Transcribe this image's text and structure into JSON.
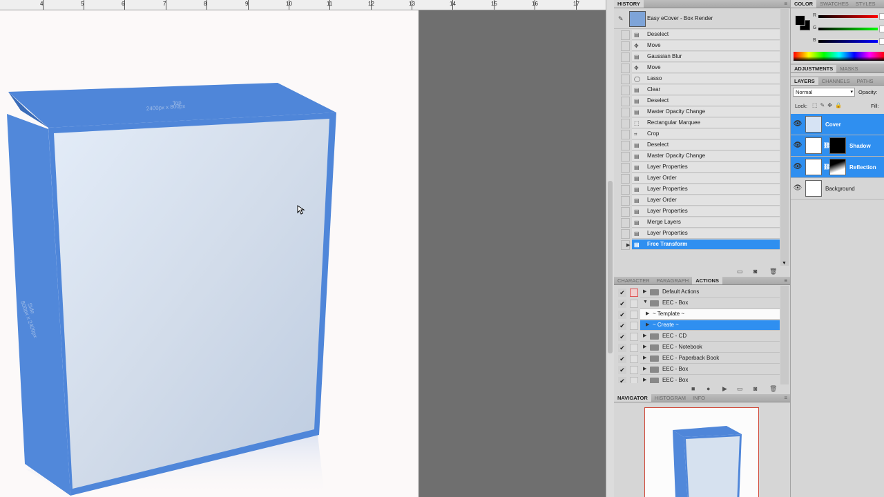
{
  "ruler": {
    "labels": [
      "4",
      "5",
      "6",
      "7",
      "8",
      "9",
      "10",
      "11",
      "12",
      "13",
      "14",
      "15",
      "16",
      "17"
    ]
  },
  "history": {
    "tab": "HISTORY",
    "snapshot_label": "Easy eCover - Box Render",
    "items": [
      "Deselect",
      "Move",
      "Gaussian Blur",
      "Move",
      "Lasso",
      "Clear",
      "Deselect",
      "Master Opacity Change",
      "Rectangular Marquee",
      "Crop",
      "Deselect",
      "Master Opacity Change",
      "Layer Properties",
      "Layer Order",
      "Layer Properties",
      "Layer Order",
      "Layer Properties",
      "Merge Layers",
      "Layer Properties",
      "Free Transform"
    ],
    "selected_item": "Free Transform"
  },
  "actions_panel": {
    "tabs": [
      "CHARACTER",
      "PARAGRAPH",
      "ACTIONS"
    ],
    "active_tab": "ACTIONS",
    "items": [
      "Default Actions",
      "EEC - Box",
      "~ Template ~",
      "~ Create ~",
      "EEC - CD",
      "EEC - Notebook",
      "EEC - Paperback Book",
      "EEC - Box",
      "EEC - Box"
    ],
    "selected_item": "~ Create ~"
  },
  "navigator": {
    "tabs": [
      "NAVIGATOR",
      "HISTOGRAM",
      "INFO"
    ],
    "active_tab": "NAVIGATOR"
  },
  "color_panel": {
    "tabs": [
      "COLOR",
      "SWATCHES",
      "STYLES"
    ],
    "active_tab": "COLOR",
    "channels": [
      "R",
      "G",
      "B"
    ],
    "foreground": "#000000",
    "background": "#000000"
  },
  "adjustments": {
    "tabs": [
      "ADJUSTMENTS",
      "MASKS"
    ],
    "active_tab": "ADJUSTMENTS"
  },
  "layers_panel": {
    "tabs": [
      "LAYERS",
      "CHANNELS",
      "PATHS"
    ],
    "active_tab": "LAYERS",
    "blend_mode": "Normal",
    "opacity_label": "Opacity:",
    "lock_label": "Lock:",
    "fill_label": "Fill:",
    "layers": [
      {
        "name": "Cover",
        "selected": true
      },
      {
        "name": "Shadow",
        "selected": true
      },
      {
        "name": "Reflection",
        "selected": true
      },
      {
        "name": "Background",
        "selected": false
      }
    ]
  },
  "box_artwork": {
    "top_label": "Top",
    "top_size": "2400px x 800px",
    "side_label": "Side",
    "side_size": "800px x 2400px"
  },
  "colors": {
    "selection": "#2f8ff0",
    "box_blue": "#4f86d9"
  }
}
